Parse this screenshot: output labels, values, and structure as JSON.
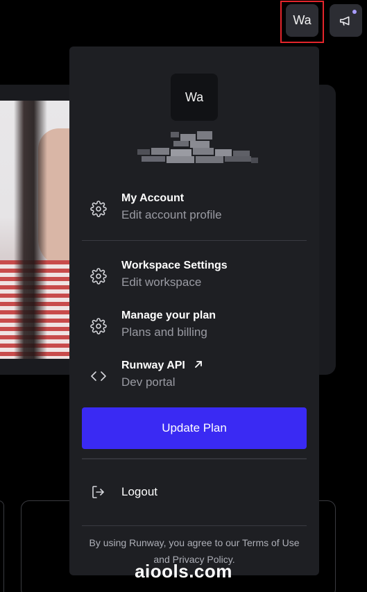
{
  "topbar": {
    "avatar_initials": "Wa",
    "announcements_icon": "megaphone-icon"
  },
  "menu": {
    "avatar_initials": "Wa",
    "items": [
      {
        "title": "My Account",
        "subtitle": "Edit account profile",
        "icon": "gear-icon"
      },
      {
        "title": "Workspace Settings",
        "subtitle": "Edit workspace",
        "icon": "gear-icon"
      },
      {
        "title": "Manage your plan",
        "subtitle": "Plans and billing",
        "icon": "gear-icon"
      },
      {
        "title": "Runway API",
        "subtitle": "Dev portal",
        "icon": "code-icon",
        "external_icon": "external-link-icon"
      }
    ],
    "update_plan_label": "Update Plan",
    "logout_label": "Logout",
    "terms_line1": "By using Runway, you agree to our Terms of Use",
    "terms_line2": "and Privacy Policy."
  },
  "watermark": "aiools.com",
  "colors": {
    "accent": "#3a2af3",
    "highlight": "#e4252b",
    "menu_bg": "#1e1f23"
  }
}
